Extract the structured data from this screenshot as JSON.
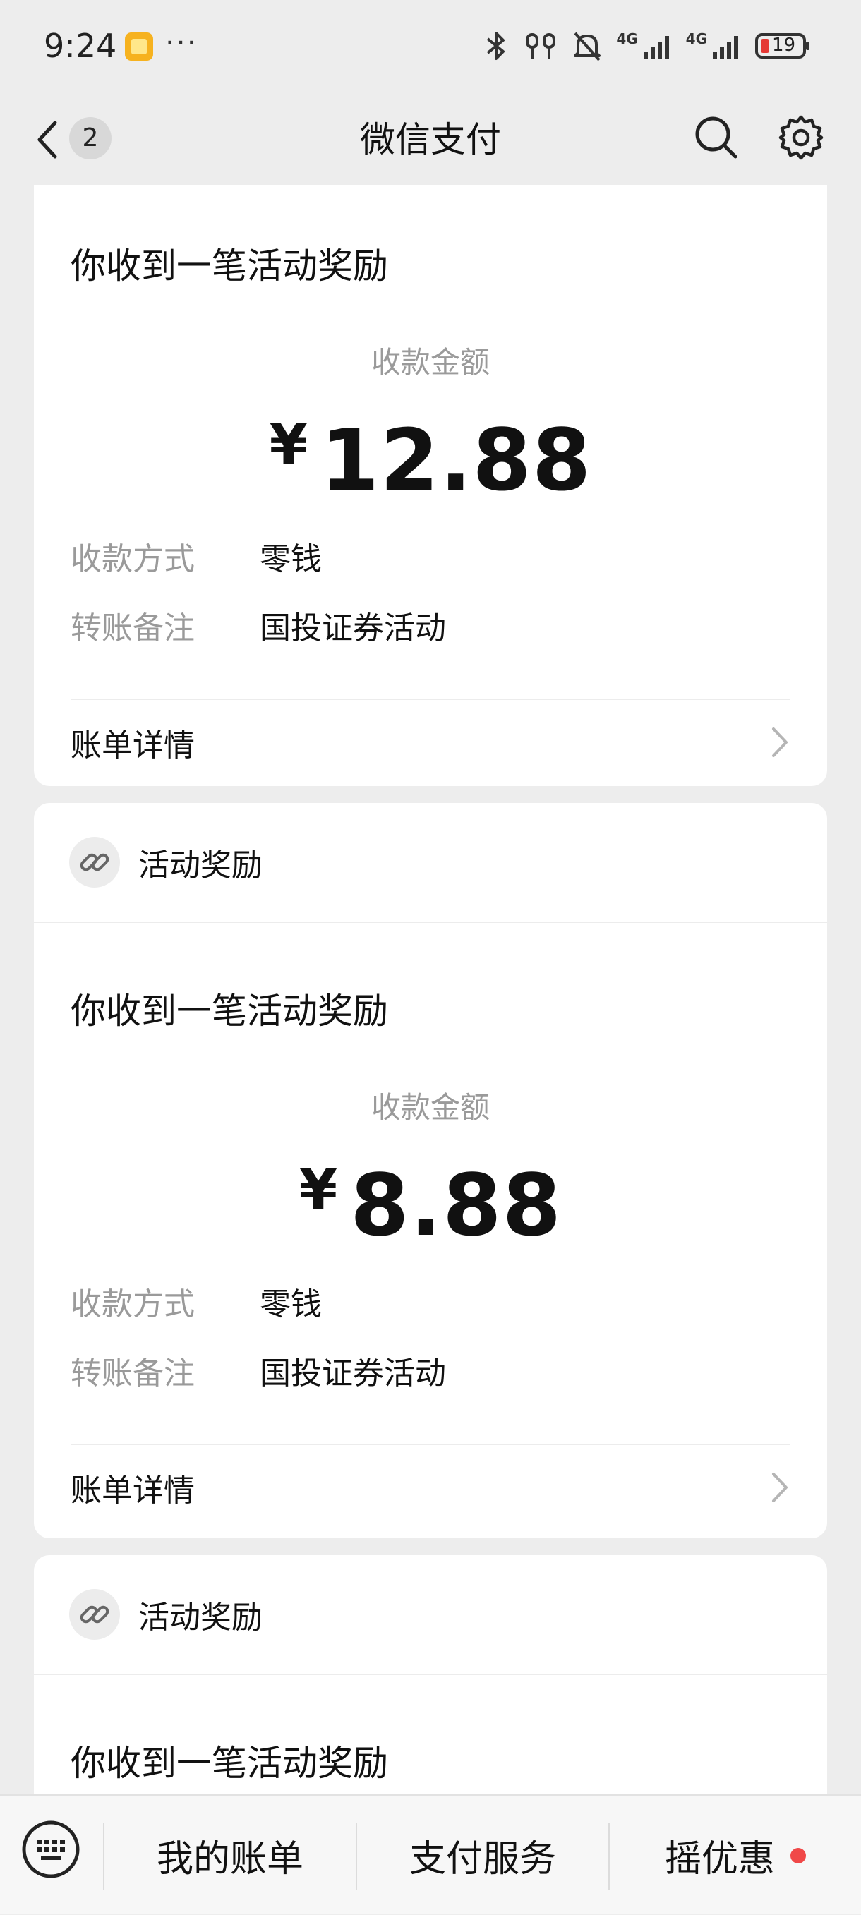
{
  "status_bar": {
    "time": "9:24",
    "more": "···",
    "signal1_label": "4G",
    "signal2_label": "4G",
    "battery": "19"
  },
  "nav": {
    "unread_count": "2",
    "title": "微信支付"
  },
  "cards": [
    {
      "message_title": "你收到一笔活动奖励",
      "amount_label": "收款金额",
      "currency": "¥",
      "amount": "12.88",
      "method_key": "收款方式",
      "method_value": "零钱",
      "remark_key": "转账备注",
      "remark_value": "国投证券活动",
      "detail_label": "账单详情"
    },
    {
      "header_title": "活动奖励",
      "message_title": "你收到一笔活动奖励",
      "amount_label": "收款金额",
      "currency": "¥",
      "amount": "8.88",
      "method_key": "收款方式",
      "method_value": "零钱",
      "remark_key": "转账备注",
      "remark_value": "国投证券活动",
      "detail_label": "账单详情"
    },
    {
      "header_title": "活动奖励",
      "message_title": "你收到一笔活动奖励"
    }
  ],
  "bottom_tabs": [
    "我的账单",
    "支付服务",
    "摇优惠"
  ],
  "colors": {
    "background": "#ededed",
    "card": "#ffffff",
    "muted_text": "#9a9a9a",
    "notification_dot": "#f04848"
  }
}
